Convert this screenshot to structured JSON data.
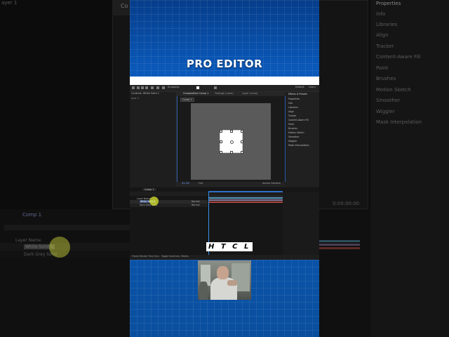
{
  "background_app": {
    "top_left_label": "ayer 1",
    "comp_tab": "Comp 1",
    "timecode": "0:00:00:00",
    "layer_name_header": "Layer Name",
    "layers": [
      {
        "index": "1",
        "name": "White Solid 1"
      },
      {
        "index": "2",
        "name": "Dark Grey Solid"
      }
    ],
    "right_panel": {
      "title": "Properties",
      "items": [
        "Info",
        "Libraries",
        "Align",
        "Tracker",
        "Content-Aware Fill",
        "Paint",
        "Brushes",
        "Motion Sketch",
        "Smoother",
        "Wiggler",
        "Mask Interpolation"
      ]
    }
  },
  "video": {
    "title": "PRO EDITOR",
    "caption": "H T  C L",
    "colors": {
      "bg_top": "#063d8a",
      "bg_mid": "#0a58b8",
      "caption_bg": "#ffffff"
    }
  },
  "embedded_app": {
    "toolbar": {
      "snapping": "Snapping",
      "default": "Default",
      "learn": "Learn"
    },
    "project_panel": {
      "title": "Controls: White Solid 1",
      "subtitle": "ayer 1"
    },
    "comp_panel": {
      "tab": "Composition Comp 1",
      "footage_tab": "Footage (none)",
      "layer_tab": "Layer (none)",
      "breadcrumb": "Comp 1",
      "zoom": "41.2%",
      "quality": "Full",
      "camera": "Active Camera"
    },
    "properties_panel": {
      "title": "Effects & Presets",
      "items": [
        "Properties",
        "Info",
        "Libraries",
        "Align",
        "Tracker",
        "Content-Aware Fill",
        "Paint",
        "Brushes",
        "Motion Sketch",
        "Smoother",
        "Wiggler",
        "Mask Interpolation"
      ]
    },
    "timeline": {
      "tab": "Comp 1",
      "layer_header": "Layer Name",
      "layers": [
        {
          "name": "White Solid 1",
          "mode": "Normal"
        },
        {
          "name": "Dark Grey Solid",
          "mode": "Normal"
        }
      ],
      "status_left": "Frame Render Time 0ms",
      "status_right": "Toggle Switches / Modes",
      "bar_colors": [
        "#56a0c4",
        "#8f7b9f",
        "#b0463f"
      ]
    }
  }
}
